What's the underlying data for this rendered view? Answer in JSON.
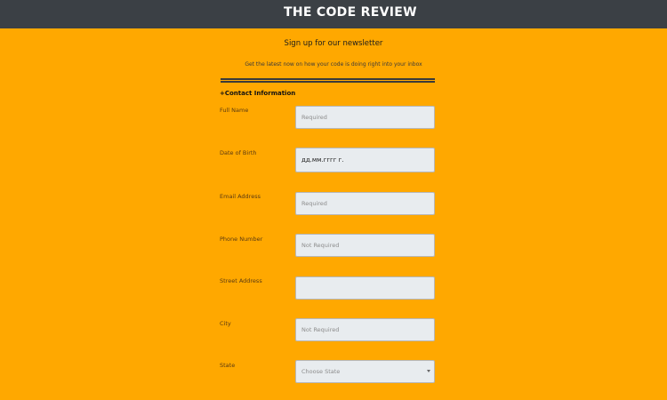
{
  "header": {
    "title": "THE CODE REVIEW"
  },
  "newsletter": {
    "heading": "Sign up for our newsletter",
    "subheading": "Get the latest now on how your code is doing right into your inbox"
  },
  "form": {
    "section_title": "+Contact Information",
    "fields": [
      {
        "label": "Full Name",
        "placeholder": "Required",
        "value": ""
      },
      {
        "label": "Date of Birth",
        "placeholder": "",
        "value": "дд.мм.гггг г."
      },
      {
        "label": "Email Address",
        "placeholder": "Required",
        "value": ""
      },
      {
        "label": "Phone Number",
        "placeholder": "Not Required",
        "value": ""
      },
      {
        "label": "Street Address",
        "placeholder": "",
        "value": ""
      },
      {
        "label": "City",
        "placeholder": "Not Required",
        "value": ""
      },
      {
        "label": "State",
        "selected": "Choose State"
      }
    ]
  },
  "colors": {
    "background": "#FFA800",
    "topbar": "#3B4045",
    "input_bg": "#E8ECEF"
  }
}
